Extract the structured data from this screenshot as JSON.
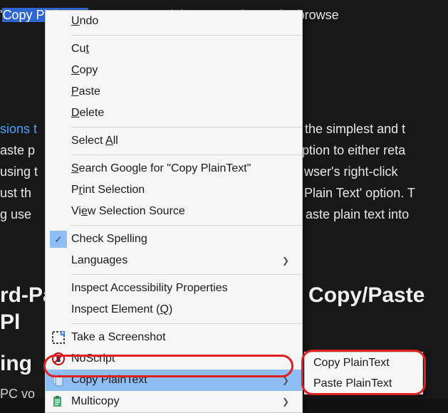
{
  "background": {
    "line1_selected": "Copy PlainText",
    "line1_rest": "' or 'Copy as Plain Text' option to the browse",
    "link2": "sions t",
    "line2_rest": "y the simplest and t",
    "line3_left": "aste p",
    "line3_right": "ption to either reta",
    "line4_left": "using t",
    "line4_right": "wser's right-click",
    "line5_left": "ust th",
    "line5_right": " Plain Text' option. T",
    "line6_left": "g use",
    "line6_right": "aste plain text into",
    "heading_left": "rd-Pa",
    "heading_right": " Copy/Paste Pl",
    "heading_line2": "ing",
    "footer": "PC  vo"
  },
  "menu": {
    "undo": "Undo",
    "cut": "Cut",
    "copy": "Copy",
    "paste": "Paste",
    "delete": "Delete",
    "select_all": "Select All",
    "search": "Search Google for \"Copy PlainText\"",
    "print": "Print Selection",
    "view_source": "View Selection Source",
    "check_spelling": "Check Spelling",
    "languages": "Languages",
    "inspect_a11y": "Inspect Accessibility Properties",
    "inspect_element": "Inspect Element (Q)",
    "screenshot": "Take a Screenshot",
    "noscript": "NoScript",
    "copy_plaintext": "Copy PlainText",
    "multicopy": "Multicopy"
  },
  "submenu": {
    "copy": "Copy PlainText",
    "paste": "Paste PlainText"
  }
}
